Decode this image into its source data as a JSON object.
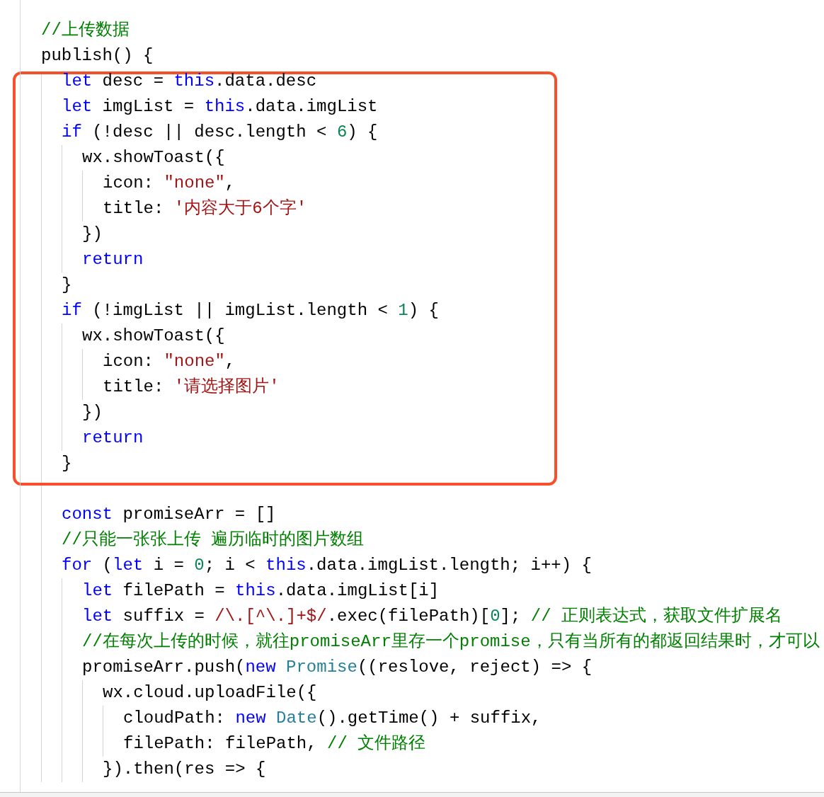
{
  "code": [
    {
      "tokens": [
        {
          "kind": "comment",
          "text": "//上传数据"
        }
      ]
    },
    {
      "tokens": [
        {
          "kind": "plain",
          "text": "publish() {"
        }
      ],
      "children": [
        {
          "boxed": true,
          "tokens": [
            {
              "kind": "keyword",
              "text": "let"
            },
            {
              "kind": "plain",
              "text": " desc = "
            },
            {
              "kind": "keyword",
              "text": "this"
            },
            {
              "kind": "plain",
              "text": ".data.desc"
            }
          ]
        },
        {
          "boxed": true,
          "tokens": [
            {
              "kind": "keyword",
              "text": "let"
            },
            {
              "kind": "plain",
              "text": " imgList = "
            },
            {
              "kind": "keyword",
              "text": "this"
            },
            {
              "kind": "plain",
              "text": ".data.imgList"
            }
          ]
        },
        {
          "boxed": true,
          "tokens": [
            {
              "kind": "keyword",
              "text": "if"
            },
            {
              "kind": "plain",
              "text": " (!desc || desc.length < "
            },
            {
              "kind": "number",
              "text": "6"
            },
            {
              "kind": "plain",
              "text": ") {"
            }
          ],
          "children": [
            {
              "tokens": [
                {
                  "kind": "plain",
                  "text": "wx.showToast({"
                }
              ],
              "children": [
                {
                  "tokens": [
                    {
                      "kind": "plain",
                      "text": "icon: "
                    },
                    {
                      "kind": "string",
                      "text": "\"none\""
                    },
                    {
                      "kind": "plain",
                      "text": ","
                    }
                  ]
                },
                {
                  "tokens": [
                    {
                      "kind": "plain",
                      "text": "title: "
                    },
                    {
                      "kind": "string",
                      "text": "'内容大于6个字'"
                    }
                  ]
                }
              ]
            },
            {
              "tokens": [
                {
                  "kind": "plain",
                  "text": "})"
                }
              ]
            },
            {
              "tokens": [
                {
                  "kind": "keyword",
                  "text": "return"
                }
              ]
            }
          ]
        },
        {
          "boxed": true,
          "tokens": [
            {
              "kind": "plain",
              "text": "}"
            }
          ]
        },
        {
          "boxed": true,
          "tokens": [
            {
              "kind": "keyword",
              "text": "if"
            },
            {
              "kind": "plain",
              "text": " (!imgList || imgList.length < "
            },
            {
              "kind": "number",
              "text": "1"
            },
            {
              "kind": "plain",
              "text": ") {"
            }
          ],
          "children": [
            {
              "tokens": [
                {
                  "kind": "plain",
                  "text": "wx.showToast({"
                }
              ],
              "children": [
                {
                  "tokens": [
                    {
                      "kind": "plain",
                      "text": "icon: "
                    },
                    {
                      "kind": "string",
                      "text": "\"none\""
                    },
                    {
                      "kind": "plain",
                      "text": ","
                    }
                  ]
                },
                {
                  "tokens": [
                    {
                      "kind": "plain",
                      "text": "title: "
                    },
                    {
                      "kind": "string",
                      "text": "'请选择图片'"
                    }
                  ]
                }
              ]
            },
            {
              "tokens": [
                {
                  "kind": "plain",
                  "text": "})"
                }
              ]
            },
            {
              "tokens": [
                {
                  "kind": "keyword",
                  "text": "return"
                }
              ]
            }
          ]
        },
        {
          "boxed": true,
          "tokens": [
            {
              "kind": "plain",
              "text": "}"
            }
          ]
        },
        {
          "boxed": false,
          "tokens": [
            {
              "kind": "keyword",
              "text": "const"
            },
            {
              "kind": "plain",
              "text": " promiseArr = []"
            }
          ]
        },
        {
          "boxed": false,
          "tokens": [
            {
              "kind": "comment",
              "text": "//只能一张张上传 遍历临时的图片数组"
            }
          ]
        },
        {
          "boxed": false,
          "tokens": [
            {
              "kind": "keyword",
              "text": "for"
            },
            {
              "kind": "plain",
              "text": " ("
            },
            {
              "kind": "keyword",
              "text": "let"
            },
            {
              "kind": "plain",
              "text": " i = "
            },
            {
              "kind": "number",
              "text": "0"
            },
            {
              "kind": "plain",
              "text": "; i < "
            },
            {
              "kind": "keyword",
              "text": "this"
            },
            {
              "kind": "plain",
              "text": ".data.imgList.length; i++) {"
            }
          ],
          "children": [
            {
              "tokens": [
                {
                  "kind": "keyword",
                  "text": "let"
                },
                {
                  "kind": "plain",
                  "text": " filePath = "
                },
                {
                  "kind": "keyword",
                  "text": "this"
                },
                {
                  "kind": "plain",
                  "text": ".data.imgList[i]"
                }
              ]
            },
            {
              "tokens": [
                {
                  "kind": "keyword",
                  "text": "let"
                },
                {
                  "kind": "plain",
                  "text": " suffix = "
                },
                {
                  "kind": "string",
                  "text": "/\\.[^\\.]+$/"
                },
                {
                  "kind": "plain",
                  "text": ".exec(filePath)["
                },
                {
                  "kind": "number",
                  "text": "0"
                },
                {
                  "kind": "plain",
                  "text": "]; "
                },
                {
                  "kind": "comment",
                  "text": "// 正则表达式，获取文件扩展名"
                }
              ]
            },
            {
              "tokens": [
                {
                  "kind": "comment",
                  "text": "//在每次上传的时候，就往promiseArr里存一个promise，只有当所有的都返回结果时，才可以"
                }
              ]
            },
            {
              "tokens": [
                {
                  "kind": "plain",
                  "text": "promiseArr.push("
                },
                {
                  "kind": "keyword",
                  "text": "new "
                },
                {
                  "kind": "class",
                  "text": "Promise"
                },
                {
                  "kind": "plain",
                  "text": "((reslove, reject) => {"
                }
              ],
              "children": [
                {
                  "tokens": [
                    {
                      "kind": "plain",
                      "text": "wx.cloud.uploadFile({"
                    }
                  ],
                  "children": [
                    {
                      "tokens": [
                        {
                          "kind": "plain",
                          "text": "cloudPath: "
                        },
                        {
                          "kind": "keyword",
                          "text": "new "
                        },
                        {
                          "kind": "class",
                          "text": "Date"
                        },
                        {
                          "kind": "plain",
                          "text": "().getTime() + suffix,"
                        }
                      ]
                    },
                    {
                      "tokens": [
                        {
                          "kind": "plain",
                          "text": "filePath: filePath, "
                        },
                        {
                          "kind": "comment",
                          "text": "// 文件路径"
                        }
                      ]
                    }
                  ]
                },
                {
                  "tokens": [
                    {
                      "kind": "plain",
                      "text": "}).then(res => {"
                    }
                  ]
                }
              ]
            }
          ]
        }
      ]
    }
  ]
}
